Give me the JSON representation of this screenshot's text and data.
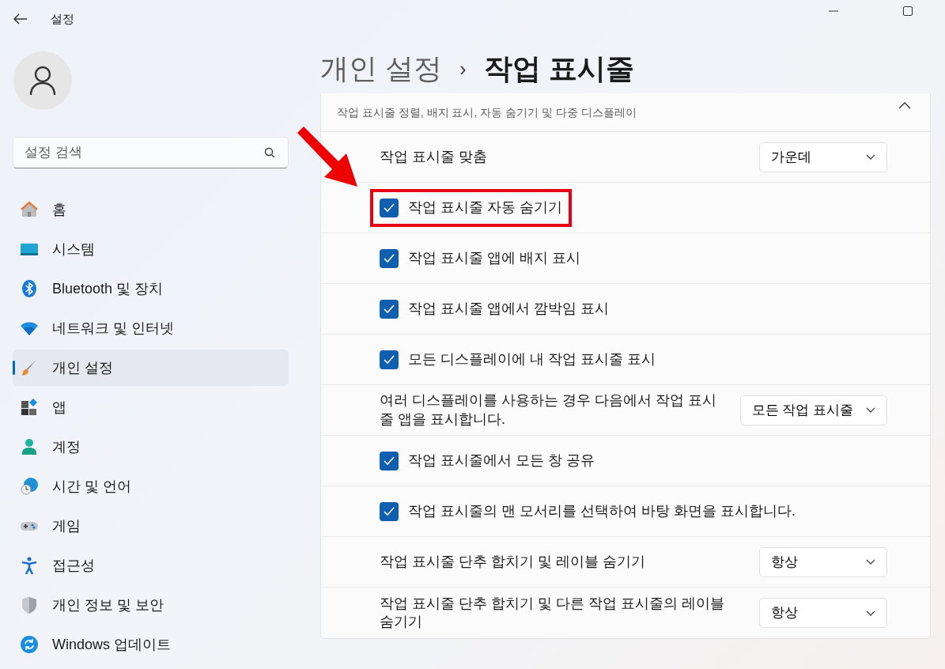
{
  "window": {
    "title": "설정"
  },
  "search": {
    "placeholder": "설정 검색"
  },
  "sidebar": {
    "items": [
      {
        "label": "홈",
        "selected": false
      },
      {
        "label": "시스템",
        "selected": false
      },
      {
        "label": "Bluetooth 및 장치",
        "selected": false
      },
      {
        "label": "네트워크 및 인터넷",
        "selected": false
      },
      {
        "label": "개인 설정",
        "selected": true
      },
      {
        "label": "앱",
        "selected": false
      },
      {
        "label": "계정",
        "selected": false
      },
      {
        "label": "시간 및 언어",
        "selected": false
      },
      {
        "label": "게임",
        "selected": false
      },
      {
        "label": "접근성",
        "selected": false
      },
      {
        "label": "개인 정보 및 보안",
        "selected": false
      },
      {
        "label": "Windows 업데이트",
        "selected": false
      }
    ]
  },
  "breadcrumb": {
    "parent": "개인 설정",
    "separator": "›",
    "current": "작업 표시줄"
  },
  "section": {
    "subtitle": "작업 표시줄 정렬, 배지 표시, 자동 숨기기 및 다중 디스플레이",
    "expanded": true
  },
  "settings": [
    {
      "kind": "dropdown",
      "label": "작업 표시줄 맞춤",
      "value": "가운데",
      "highlighted": false
    },
    {
      "kind": "checkbox",
      "label": "작업 표시줄 자동 숨기기",
      "checked": true,
      "highlighted": true
    },
    {
      "kind": "checkbox",
      "label": "작업 표시줄 앱에 배지 표시",
      "checked": true,
      "highlighted": false
    },
    {
      "kind": "checkbox",
      "label": "작업 표시줄 앱에서 깜박임 표시",
      "checked": true,
      "highlighted": false
    },
    {
      "kind": "checkbox",
      "label": "모든 디스플레이에 내 작업 표시줄 표시",
      "checked": true,
      "highlighted": false
    },
    {
      "kind": "dropdown",
      "label": "여러 디스플레이를 사용하는 경우 다음에서 작업 표시줄 앱을 표시합니다.",
      "value": "모든 작업 표시줄",
      "highlighted": false
    },
    {
      "kind": "checkbox",
      "label": "작업 표시줄에서 모든 창 공유",
      "checked": true,
      "highlighted": false
    },
    {
      "kind": "checkbox",
      "label": "작업 표시줄의 맨 모서리를 선택하여 바탕 화면을 표시합니다.",
      "checked": true,
      "highlighted": false
    },
    {
      "kind": "dropdown",
      "label": "작업 표시줄 단추 합치기 및 레이블 숨기기",
      "value": "항상",
      "highlighted": false
    },
    {
      "kind": "dropdown",
      "label": "작업 표시줄 단추 합치기 및 다른 작업 표시줄의 레이블 숨기기",
      "value": "항상",
      "highlighted": false
    }
  ]
}
